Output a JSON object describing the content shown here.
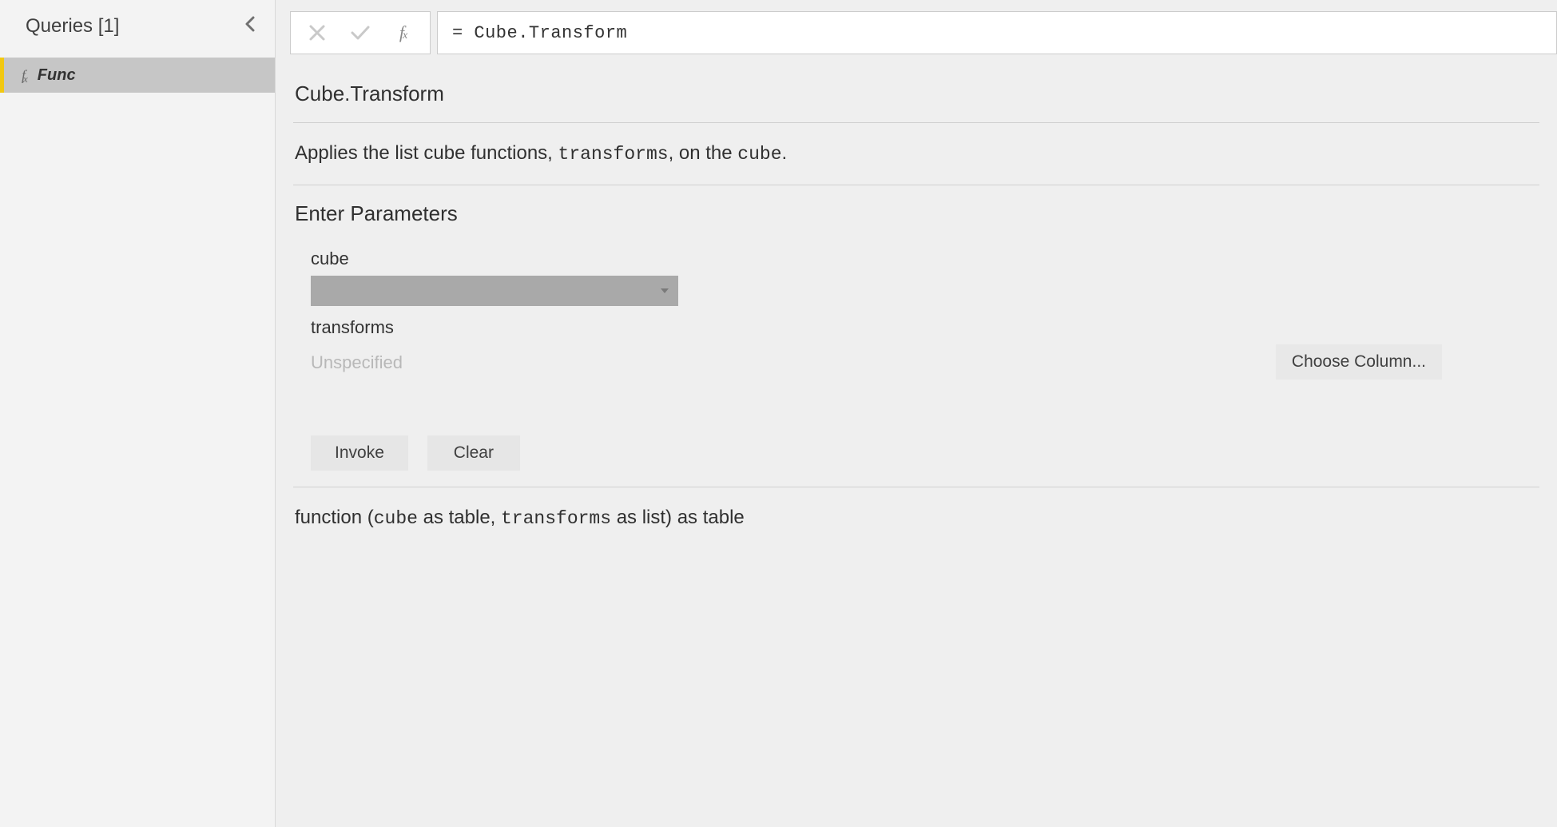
{
  "sidebar": {
    "title": "Queries [1]",
    "item": {
      "name": "Func"
    }
  },
  "formula_bar": {
    "expression": "= Cube.Transform"
  },
  "function": {
    "name": "Cube.Transform",
    "description_prefix": "Applies the list cube functions, ",
    "description_mono1": "transforms",
    "description_mid": ", on the ",
    "description_mono2": "cube",
    "description_suffix": ".",
    "params_header": "Enter Parameters",
    "param1_label": "cube",
    "param2_label": "transforms",
    "param2_value": "Unspecified",
    "choose_column_label": "Choose Column...",
    "invoke_label": "Invoke",
    "clear_label": "Clear",
    "sig_prefix": "function (",
    "sig_p1": "cube",
    "sig_t1": " as table, ",
    "sig_p2": "transforms",
    "sig_t2": " as list) as table"
  }
}
